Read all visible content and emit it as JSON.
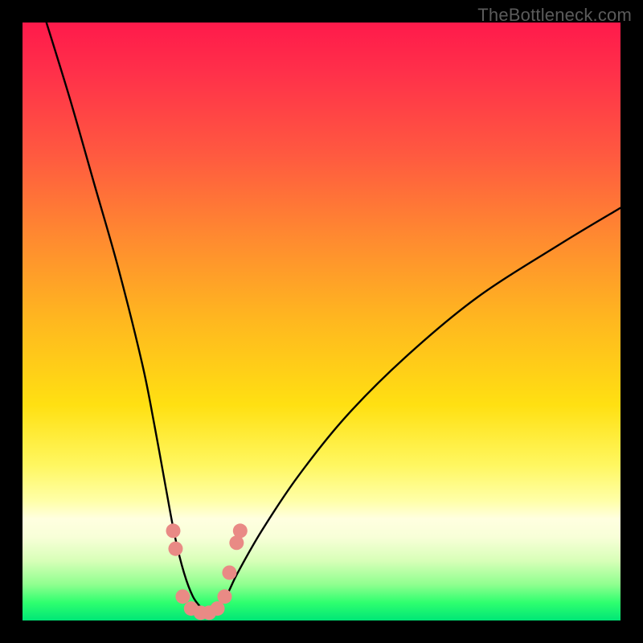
{
  "watermark": "TheBottleneck.com",
  "chart_data": {
    "type": "line",
    "title": "",
    "xlabel": "",
    "ylabel": "",
    "xlim": [
      0,
      100
    ],
    "ylim": [
      0,
      100
    ],
    "background_gradient": {
      "top_color": "#ff1a4b",
      "mid_color": "#ffe012",
      "bottom_color": "#00e676",
      "meaning": "performance zone (red=bad, green=good)"
    },
    "series": [
      {
        "name": "bottleneck-curve",
        "x": [
          4,
          8,
          12,
          16,
          20,
          22,
          24,
          25.5,
          27,
          28.5,
          30,
          31,
          32,
          34,
          36,
          40,
          46,
          54,
          64,
          76,
          90,
          100
        ],
        "y": [
          100,
          87,
          73,
          59,
          43,
          33,
          22,
          14,
          8,
          4,
          2,
          1,
          2,
          4,
          8,
          15,
          24,
          34,
          44,
          54,
          63,
          69
        ]
      }
    ],
    "markers": {
      "name": "highlighted-points",
      "color": "#e98a85",
      "points": [
        {
          "x": 25.2,
          "y": 15
        },
        {
          "x": 25.6,
          "y": 12
        },
        {
          "x": 26.8,
          "y": 4
        },
        {
          "x": 28.2,
          "y": 2
        },
        {
          "x": 29.8,
          "y": 1.3
        },
        {
          "x": 31.2,
          "y": 1.3
        },
        {
          "x": 32.6,
          "y": 2
        },
        {
          "x": 33.8,
          "y": 4
        },
        {
          "x": 34.6,
          "y": 8
        },
        {
          "x": 35.8,
          "y": 13
        },
        {
          "x": 36.4,
          "y": 15
        }
      ]
    }
  }
}
